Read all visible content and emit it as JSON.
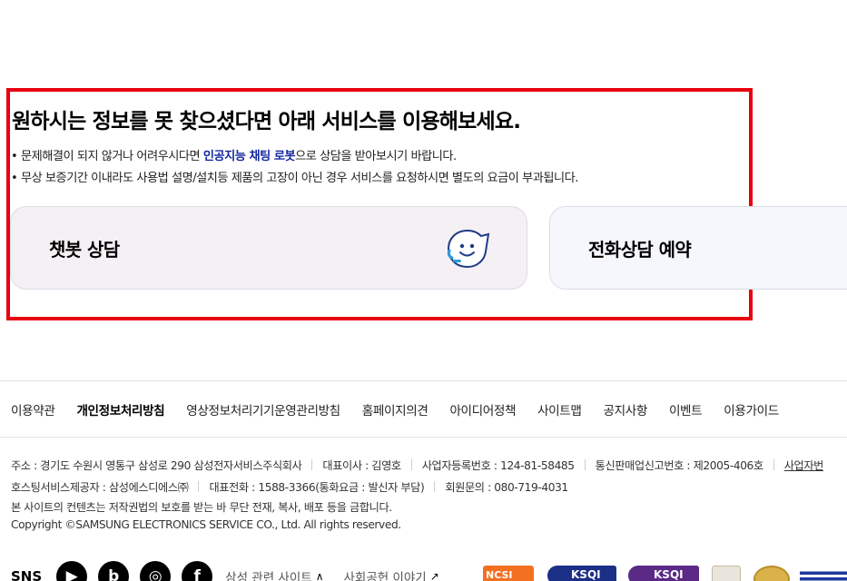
{
  "main": {
    "headline": "원하시는 정보를 못 찾으셨다면 아래 서비스를 이용해보세요.",
    "bullet1_prefix": "• 문제해결이 되지 않거나 어려우시다면 ",
    "bullet1_highlight": "인공지능 채팅 로봇",
    "bullet1_suffix": "으로 상담을 받아보시기 바랍니다.",
    "bullet2": "• 무상 보증기간 이내라도 사용법 설명/설치등 제품의 고장이 아닌 경우 서비스를 요청하시면 별도의 요금이 부과됩니다.",
    "cards": [
      {
        "label": "챗봇 상담",
        "icon": "chatbot-face-icon"
      },
      {
        "label": "전화상담 예약"
      }
    ],
    "highlight_color": "#e8000f"
  },
  "footer": {
    "nav": [
      {
        "label": "이용약관"
      },
      {
        "label": "개인정보처리방침"
      },
      {
        "label": "영상정보처리기기운영관리방침"
      },
      {
        "label": "홈페이지의견"
      },
      {
        "label": "아이디어정책"
      },
      {
        "label": "사이트맵"
      },
      {
        "label": "공지사항"
      },
      {
        "label": "이벤트"
      },
      {
        "label": "이용가이드"
      }
    ],
    "info": {
      "address": "주소 : 경기도 수원시 영통구 삼성로 290 삼성전자서비스주식회사",
      "ceo": "대표이사 : 김영호",
      "business_no": "사업자등록번호 : 124-81-58485",
      "mail_order_no": "통신판매업신고번호 : 제2005-406호",
      "business_info_link": "사업자번",
      "hosting": "호스팅서비스제공자 : 삼성에스디에스㈜",
      "phone": "대표전화 : 1588-3366(통화요금 : 발신자 부담)",
      "member_inquiry": "회원문의 : 080-719-4031",
      "copyright_notice": "본 사이트의 컨텐츠는 저작권법의 보호를 받는 바 무단 전재, 복사, 배포 등을 금합니다.",
      "copyright": "Copyright ©SAMSUNG ELECTRONICS SERVICE CO., Ltd. All rights reserved."
    },
    "sns_label": "SNS",
    "sns_icons": [
      "youtube-icon",
      "blog-icon",
      "instagram-icon",
      "facebook-icon"
    ],
    "related_sites": "삼성 관련 사이트",
    "social_story": "사회공헌 이야기",
    "certifications": {
      "ncsi": "NCSI",
      "ksqi1": "KSQI",
      "ksqi2": "KSQI"
    }
  }
}
